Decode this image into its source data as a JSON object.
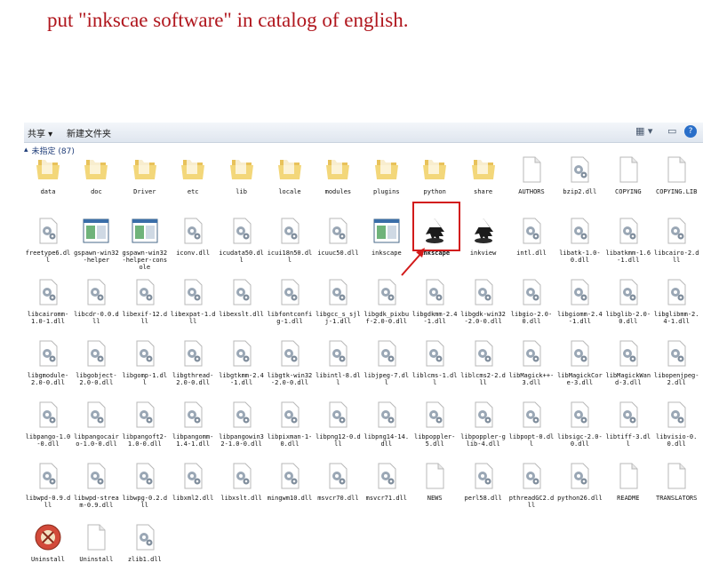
{
  "headline": "put \"inkscae software\" in catalog of english.",
  "toolbar": {
    "share": "共享 ▾",
    "new_folder": "新建文件夹",
    "help": "?"
  },
  "group": {
    "label": "未指定 (87)"
  },
  "colors": {
    "highlight": "#d21a1a",
    "headline": "#b0161d",
    "folder": "#f0cf6a"
  },
  "files": [
    {
      "name": "data",
      "type": "folder"
    },
    {
      "name": "doc",
      "type": "folder"
    },
    {
      "name": "Driver",
      "type": "folder"
    },
    {
      "name": "etc",
      "type": "folder"
    },
    {
      "name": "lib",
      "type": "folder"
    },
    {
      "name": "locale",
      "type": "folder"
    },
    {
      "name": "modules",
      "type": "folder"
    },
    {
      "name": "plugins",
      "type": "folder"
    },
    {
      "name": "python",
      "type": "folder"
    },
    {
      "name": "share",
      "type": "folder"
    },
    {
      "name": "AUTHORS",
      "type": "doc"
    },
    {
      "name": "bzip2.dll",
      "type": "dll"
    },
    {
      "name": "COPYING",
      "type": "doc"
    },
    {
      "name": "COPYING.LIB",
      "type": "doc"
    },
    {
      "name": "freetype6.dll",
      "type": "dll"
    },
    {
      "name": "gspawn-win32-helper",
      "type": "exe"
    },
    {
      "name": "gspawn-win32-helper-console",
      "type": "exe"
    },
    {
      "name": "iconv.dll",
      "type": "dll"
    },
    {
      "name": "icudata50.dll",
      "type": "dll"
    },
    {
      "name": "icui18n50.dll",
      "type": "dll"
    },
    {
      "name": "icuuc50.dll",
      "type": "dll"
    },
    {
      "name": "inkscape",
      "type": "exe"
    },
    {
      "name": "inkscape",
      "type": "inkscape"
    },
    {
      "name": "inkview",
      "type": "inkscape"
    },
    {
      "name": "intl.dll",
      "type": "dll"
    },
    {
      "name": "libatk-1.0-0.dll",
      "type": "dll"
    },
    {
      "name": "libatkmm-1.6-1.dll",
      "type": "dll"
    },
    {
      "name": "libcairo-2.dll",
      "type": "dll"
    },
    {
      "name": "libcairomm-1.0-1.dll",
      "type": "dll"
    },
    {
      "name": "libcdr-0.0.dll",
      "type": "dll"
    },
    {
      "name": "libexif-12.dll",
      "type": "dll"
    },
    {
      "name": "libexpat-1.dll",
      "type": "dll"
    },
    {
      "name": "libexslt.dll",
      "type": "dll"
    },
    {
      "name": "libfontconfig-1.dll",
      "type": "dll"
    },
    {
      "name": "libgcc_s_sjlj-1.dll",
      "type": "dll"
    },
    {
      "name": "libgdk_pixbuf-2.0-0.dll",
      "type": "dll"
    },
    {
      "name": "libgdkmm-2.4-1.dll",
      "type": "dll"
    },
    {
      "name": "libgdk-win32-2.0-0.dll",
      "type": "dll"
    },
    {
      "name": "libgio-2.0-0.dll",
      "type": "dll"
    },
    {
      "name": "libgiomm-2.4-1.dll",
      "type": "dll"
    },
    {
      "name": "libglib-2.0-0.dll",
      "type": "dll"
    },
    {
      "name": "libglibmm-2.4-1.dll",
      "type": "dll"
    },
    {
      "name": "libgmodule-2.0-0.dll",
      "type": "dll"
    },
    {
      "name": "libgobject-2.0-0.dll",
      "type": "dll"
    },
    {
      "name": "libgomp-1.dll",
      "type": "dll"
    },
    {
      "name": "libgthread-2.0-0.dll",
      "type": "dll"
    },
    {
      "name": "libgtkmm-2.4-1.dll",
      "type": "dll"
    },
    {
      "name": "libgtk-win32-2.0-0.dll",
      "type": "dll"
    },
    {
      "name": "libintl-8.dll",
      "type": "dll"
    },
    {
      "name": "libjpeg-7.dll",
      "type": "dll"
    },
    {
      "name": "liblcms-1.dll",
      "type": "dll"
    },
    {
      "name": "liblcms2-2.dll",
      "type": "dll"
    },
    {
      "name": "libMagick++-3.dll",
      "type": "dll"
    },
    {
      "name": "libMagickCore-3.dll",
      "type": "dll"
    },
    {
      "name": "libMagickWand-3.dll",
      "type": "dll"
    },
    {
      "name": "libopenjpeg-2.dll",
      "type": "dll"
    },
    {
      "name": "libpango-1.0-0.dll",
      "type": "dll"
    },
    {
      "name": "libpangocairo-1.0-0.dll",
      "type": "dll"
    },
    {
      "name": "libpangoft2-1.0-0.dll",
      "type": "dll"
    },
    {
      "name": "libpangomm-1.4-1.dll",
      "type": "dll"
    },
    {
      "name": "libpangowin32-1.0-0.dll",
      "type": "dll"
    },
    {
      "name": "libpixman-1-0.dll",
      "type": "dll"
    },
    {
      "name": "libpng12-0.dll",
      "type": "dll"
    },
    {
      "name": "libpng14-14.dll",
      "type": "dll"
    },
    {
      "name": "libpoppler-5.dll",
      "type": "dll"
    },
    {
      "name": "libpoppler-glib-4.dll",
      "type": "dll"
    },
    {
      "name": "libpopt-0.dll",
      "type": "dll"
    },
    {
      "name": "libsigc-2.0-0.dll",
      "type": "dll"
    },
    {
      "name": "libtiff-3.dll",
      "type": "dll"
    },
    {
      "name": "libvisio-0.0.dll",
      "type": "dll"
    },
    {
      "name": "libwpd-0.9.dll",
      "type": "dll"
    },
    {
      "name": "libwpd-stream-0.9.dll",
      "type": "dll"
    },
    {
      "name": "libwpg-0.2.dll",
      "type": "dll"
    },
    {
      "name": "libxml2.dll",
      "type": "dll"
    },
    {
      "name": "libxslt.dll",
      "type": "dll"
    },
    {
      "name": "mingwm10.dll",
      "type": "dll"
    },
    {
      "name": "msvcr70.dll",
      "type": "dll"
    },
    {
      "name": "msvcr71.dll",
      "type": "dll"
    },
    {
      "name": "NEWS",
      "type": "doc"
    },
    {
      "name": "perl58.dll",
      "type": "dll"
    },
    {
      "name": "pthreadGC2.dll",
      "type": "dll"
    },
    {
      "name": "python26.dll",
      "type": "dll"
    },
    {
      "name": "README",
      "type": "doc"
    },
    {
      "name": "TRANSLATORS",
      "type": "doc"
    },
    {
      "name": "Uninstall",
      "type": "uninstall"
    },
    {
      "name": "Uninstall",
      "type": "doc"
    },
    {
      "name": "zlib1.dll",
      "type": "dll"
    }
  ]
}
